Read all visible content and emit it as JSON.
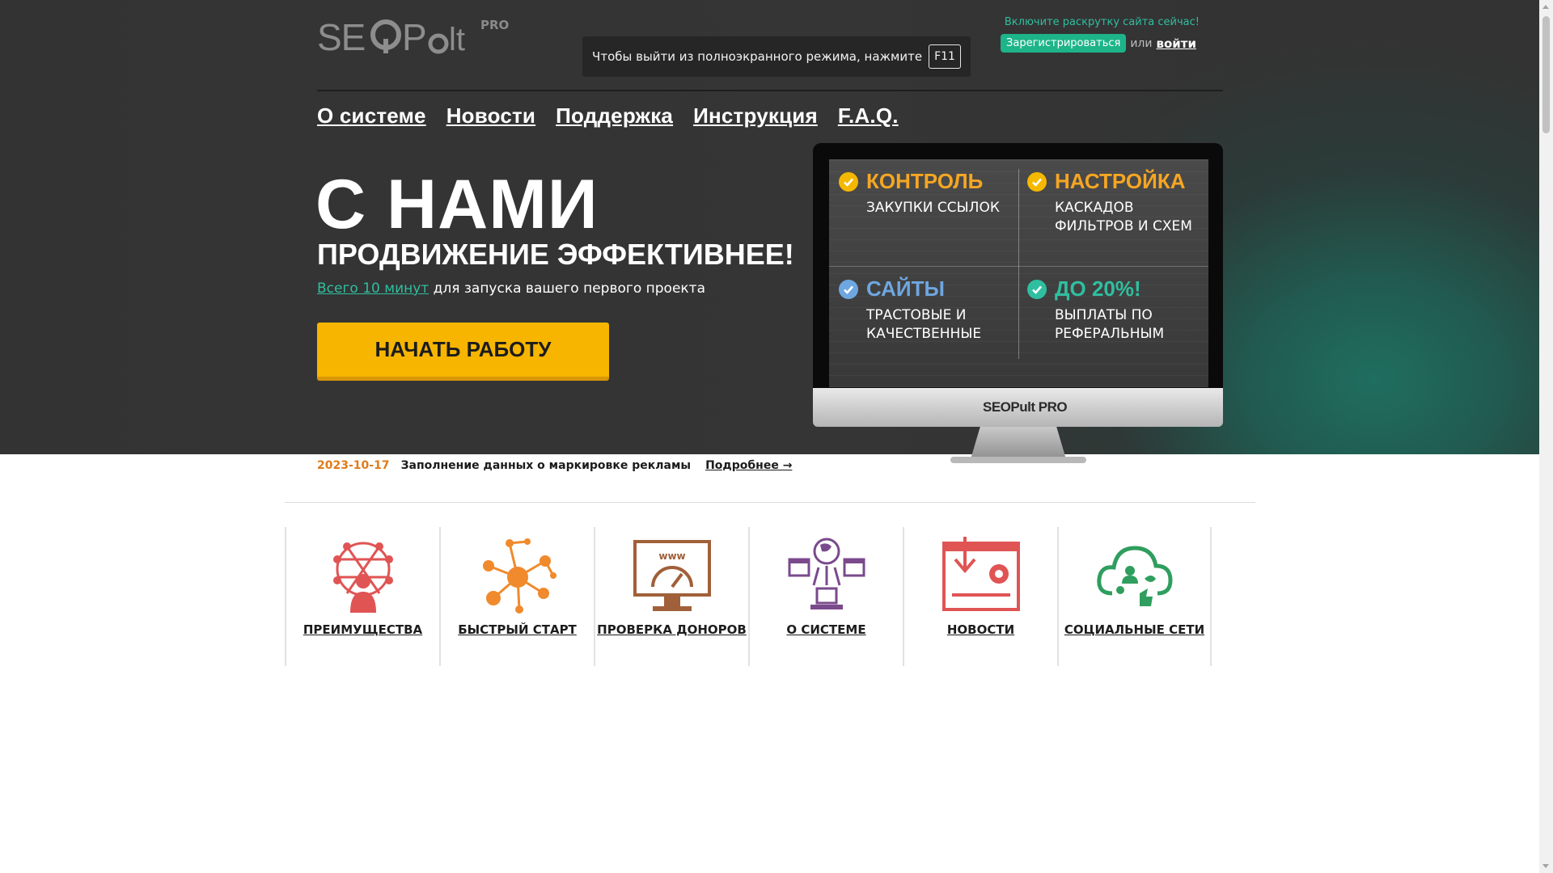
{
  "header": {
    "logo_text": "SEOPult",
    "logo_badge": "PRO",
    "fullscreen_notice": "Чтобы выйти из полноэкранного режима, нажмите",
    "fullscreen_key": "F11",
    "promo": "Включите раскрутку сайта сейчас!",
    "register_label": "Зарегистрироваться",
    "or_label": "или",
    "login_label": "войти"
  },
  "nav": {
    "items": [
      {
        "label": "О системе"
      },
      {
        "label": "Новости"
      },
      {
        "label": "Поддержка"
      },
      {
        "label": "Инструкция"
      },
      {
        "label": "F.A.Q."
      }
    ]
  },
  "hero": {
    "title": "С НАМИ",
    "subtitle": "ПРОДВИЖЕНИЕ ЭФФЕКТИВНЕЕ!",
    "lead_link": "Всего 10 минут",
    "lead_text": " для запуска вашего первого проекта",
    "cta_label": "НАЧАТЬ РАБОТУ"
  },
  "monitor": {
    "brand": "SEOPult PRO",
    "features": [
      {
        "title": "КОНТРОЛЬ",
        "text": "ЗАКУПКИ ССЫЛОК",
        "color": "#f5a623",
        "check_color": "#f5b800"
      },
      {
        "title": "НАСТРОЙКА",
        "text": "КАСКАДОВ ФИЛЬТРОВ И СХЕМ",
        "color": "#f5a623",
        "check_color": "#f5b800"
      },
      {
        "title": "САЙТЫ",
        "text": "ТРАСТОВЫЕ И КАЧЕСТВЕННЫЕ",
        "color": "#6ea7e0",
        "check_color": "#6ea7e0"
      },
      {
        "title": "ДО 20%!",
        "text": "ВЫПЛАТЫ ПО РЕФЕРАЛЬНЫМ",
        "color": "#2fbfa0",
        "check_color": "#2fbfa0"
      }
    ]
  },
  "news": {
    "date": "2023-10-17",
    "title": "Заполнение данных о маркировке рекламы",
    "more_label": "Подробнее →"
  },
  "tiles": [
    {
      "label": "ПРЕИМУЩЕСТВА",
      "icon": "network-person-icon",
      "color": "#e05454"
    },
    {
      "label": "БЫСТРЫЙ СТАРТ",
      "icon": "molecule-icon",
      "color": "#f08a2c"
    },
    {
      "label": "ПРОВЕРКА ДОНОРОВ",
      "icon": "monitor-gauge-icon",
      "color": "#a0603a"
    },
    {
      "label": "О СИСТЕМЕ",
      "icon": "globe-network-icon",
      "color": "#7a4a8c"
    },
    {
      "label": "НОВОСТИ",
      "icon": "news-window-icon",
      "color": "#e05454"
    },
    {
      "label": "СОЦИАЛЬНЫЕ СЕТИ",
      "icon": "social-cloud-icon",
      "color": "#2f9e5e"
    }
  ]
}
